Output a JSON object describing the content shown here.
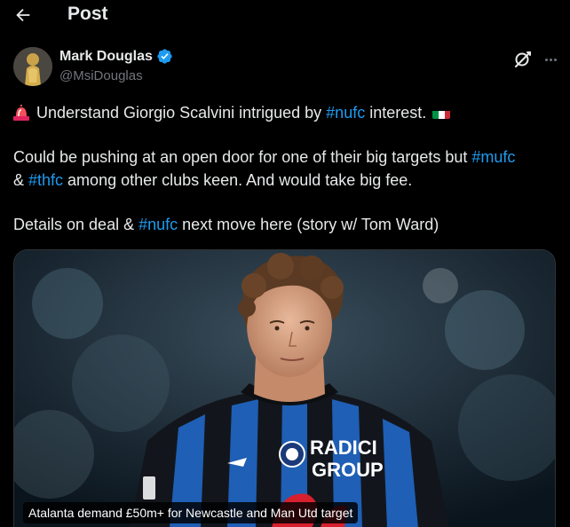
{
  "header": {
    "title": "Post"
  },
  "author": {
    "display_name": "Mark Douglas",
    "handle": "@MsiDouglas",
    "verified": true
  },
  "tweet": {
    "line1_before": "Understand Giorgio Scalvini intrigued by ",
    "line1_tag": "#nufc",
    "line1_after": " interest.",
    "line2_before": "Could be pushing at an open door for one of their big targets but ",
    "line2_tag1": "#mufc",
    "line2_amp": "& ",
    "line2_tag2": "#thfc",
    "line2_after": " among other clubs keen. And would take big fee.",
    "line3_before": "Details on deal & ",
    "line3_tag": "#nufc",
    "line3_after": " next move here (story w/ Tom Ward)"
  },
  "card": {
    "caption": "Atalanta demand £50m+ for Newcastle and Man Utd target",
    "shirt_sponsor": "RADICI GROUP"
  },
  "icons": {
    "back": "arrow-left-icon",
    "verified": "verified-badge-icon",
    "grok": "grok-icon",
    "more": "more-icon",
    "siren": "siren-emoji",
    "flag": "italy-flag-emoji"
  },
  "colors": {
    "background": "#000000",
    "text": "#e7e9ea",
    "muted": "#71767b",
    "accent": "#1d9bf0"
  }
}
